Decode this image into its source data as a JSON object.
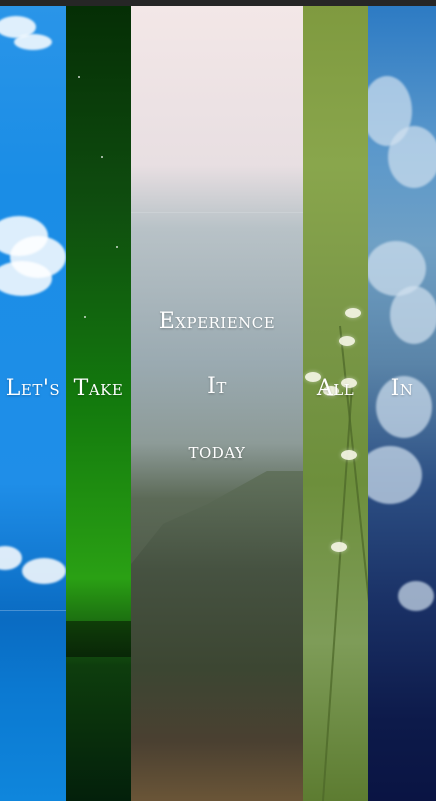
{
  "panels": [
    {
      "word": "Let's"
    },
    {
      "word": "Take"
    },
    {
      "words": [
        "Experience",
        "It",
        "today"
      ]
    },
    {
      "word": "All"
    },
    {
      "word": "In"
    }
  ]
}
